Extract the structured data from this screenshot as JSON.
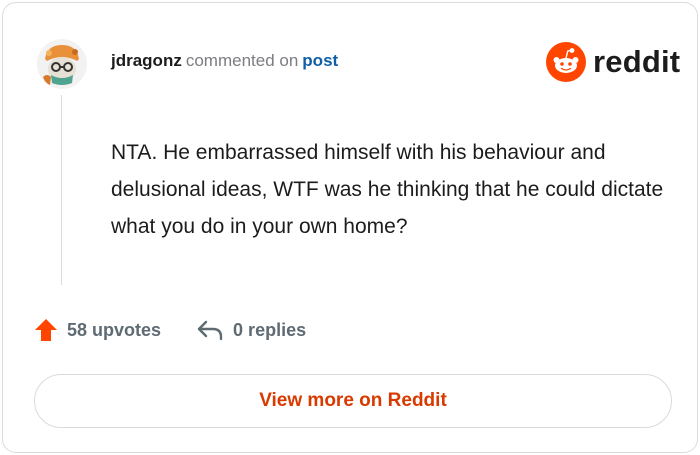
{
  "header": {
    "username": "jdragonz",
    "action_text": "commented on",
    "link_text": "post"
  },
  "logo": {
    "text": "reddit",
    "icon": "reddit-snoo-icon",
    "brand_color": "#FF4500"
  },
  "comment": {
    "body": "NTA. He embarrassed himself with his behaviour and delusional ideas, WTF was he thinking that he could dictate what you do in your own home?"
  },
  "actions": {
    "upvotes_label": "58 upvotes",
    "upvote_icon": "upvote-arrow-icon",
    "upvote_color": "#FF4500",
    "replies_label": "0 replies",
    "reply_icon": "reply-arrow-icon"
  },
  "footer": {
    "view_more_label": "View more on Reddit",
    "accent_color": "#D93A00"
  }
}
